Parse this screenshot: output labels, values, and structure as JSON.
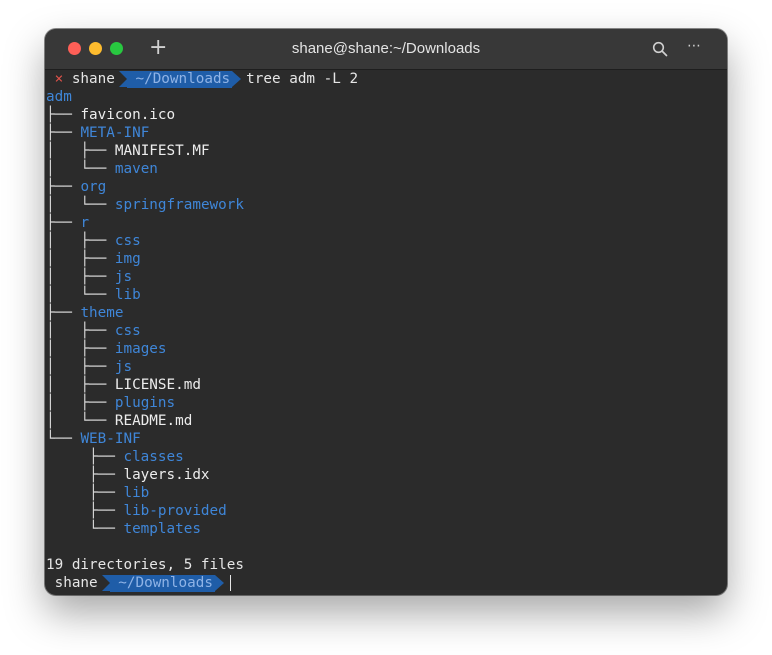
{
  "window": {
    "title": "shane@shane:~/Downloads",
    "new_tab_label": "+",
    "more_label": "⋯"
  },
  "prompt": {
    "status_mark": "×",
    "user": "shane",
    "path": "~/Downloads",
    "command": "tree adm -L 2"
  },
  "tree": [
    {
      "prefix": "",
      "name": "adm",
      "type": "dir"
    },
    {
      "prefix": "├── ",
      "name": "favicon.ico",
      "type": "file"
    },
    {
      "prefix": "├── ",
      "name": "META-INF",
      "type": "dir"
    },
    {
      "prefix": "│   ├── ",
      "name": "MANIFEST.MF",
      "type": "file"
    },
    {
      "prefix": "│   └── ",
      "name": "maven",
      "type": "dir"
    },
    {
      "prefix": "├── ",
      "name": "org",
      "type": "dir"
    },
    {
      "prefix": "│   └── ",
      "name": "springframework",
      "type": "dir"
    },
    {
      "prefix": "├── ",
      "name": "r",
      "type": "dir"
    },
    {
      "prefix": "│   ├── ",
      "name": "css",
      "type": "dir"
    },
    {
      "prefix": "│   ├── ",
      "name": "img",
      "type": "dir"
    },
    {
      "prefix": "│   ├── ",
      "name": "js",
      "type": "dir"
    },
    {
      "prefix": "│   └── ",
      "name": "lib",
      "type": "dir"
    },
    {
      "prefix": "├── ",
      "name": "theme",
      "type": "dir"
    },
    {
      "prefix": "│   ├── ",
      "name": "css",
      "type": "dir"
    },
    {
      "prefix": "│   ├── ",
      "name": "images",
      "type": "dir"
    },
    {
      "prefix": "│   ├── ",
      "name": "js",
      "type": "dir"
    },
    {
      "prefix": "│   ├── ",
      "name": "LICENSE.md",
      "type": "file"
    },
    {
      "prefix": "│   ├── ",
      "name": "plugins",
      "type": "dir"
    },
    {
      "prefix": "│   └── ",
      "name": "README.md",
      "type": "file"
    },
    {
      "prefix": "└── ",
      "name": "WEB-INF",
      "type": "dir"
    },
    {
      "prefix": "     ├── ",
      "name": "classes",
      "type": "dir"
    },
    {
      "prefix": "     ├── ",
      "name": "layers.idx",
      "type": "file"
    },
    {
      "prefix": "     ├── ",
      "name": "lib",
      "type": "dir"
    },
    {
      "prefix": "     ├── ",
      "name": "lib-provided",
      "type": "dir"
    },
    {
      "prefix": "     └── ",
      "name": "templates",
      "type": "dir"
    }
  ],
  "summary": "19 directories, 5 files",
  "prompt2": {
    "user": "shane",
    "path": "~/Downloads"
  },
  "colors": {
    "dir": "#3f86d8",
    "file": "#ececec",
    "path_segment": "#1f5da8",
    "error_mark": "#e0524a"
  }
}
